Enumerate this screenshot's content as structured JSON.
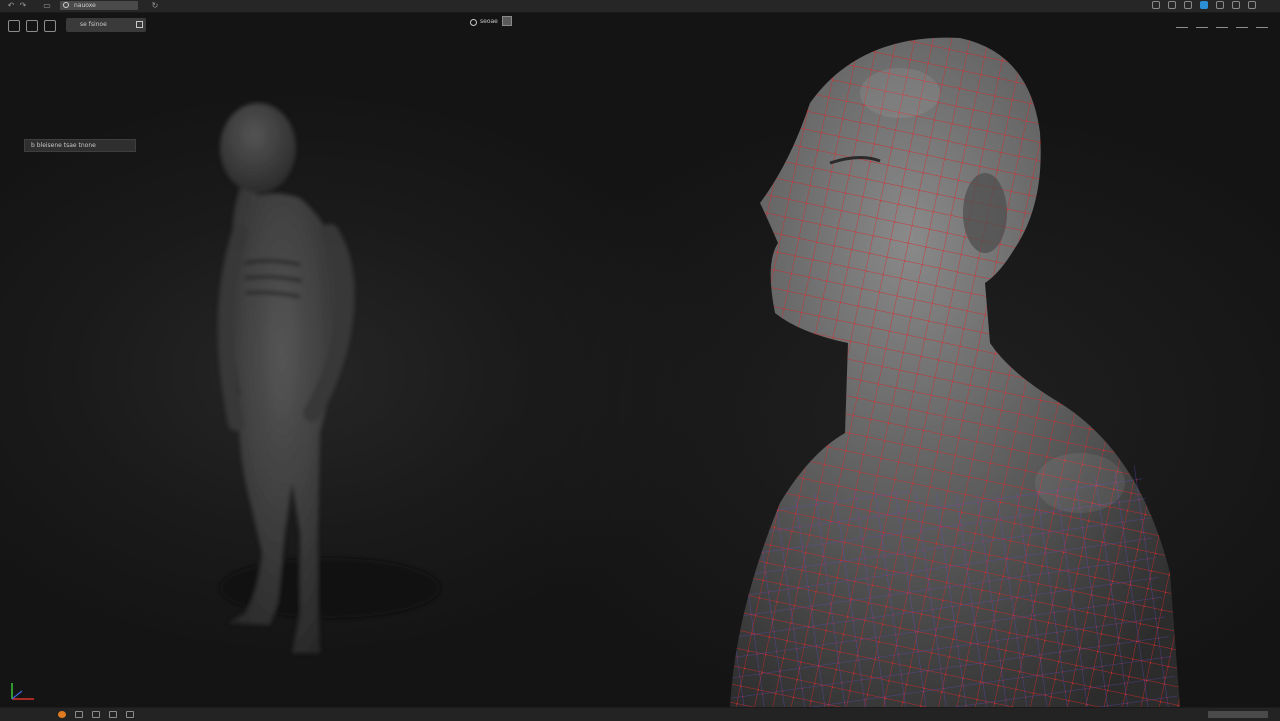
{
  "topbar": {
    "search_field_value": "nauoxe",
    "colors": {
      "background": "#262626",
      "accent": "#2b8fd6"
    },
    "left_icons": [
      "undo-icon",
      "redo-icon",
      "file-icon"
    ],
    "right_icons": [
      "sync-icon",
      "doc-icon",
      "layers-icon",
      "app-icon",
      "heart-icon",
      "share-icon",
      "user-icon"
    ]
  },
  "viewport": {
    "toolbar_icons": [
      "frame-icon",
      "crop-icon",
      "transform-icon"
    ],
    "display_mode_label": "se fsinoe",
    "center_label": "seoae",
    "scene_label": "b bleisene tsae tnone",
    "right_icons": [
      "move-icon",
      "scale-icon",
      "rotate-icon",
      "pin-icon",
      "more-icon"
    ],
    "axis_colors": {
      "x": "#d9322b",
      "y": "#3cc13b",
      "z": "#3a66d9"
    }
  },
  "scene": {
    "figures": [
      "full-body-sculpt",
      "head-bust-wireframe"
    ],
    "wire_color_primary": "#d2282a",
    "wire_color_secondary": "#5e4ad0"
  },
  "statusbar": {
    "icons": [
      "menu-icon",
      "render-icon",
      "camera-icon",
      "film-icon",
      "user-icon"
    ],
    "accent": "#e07b22"
  }
}
